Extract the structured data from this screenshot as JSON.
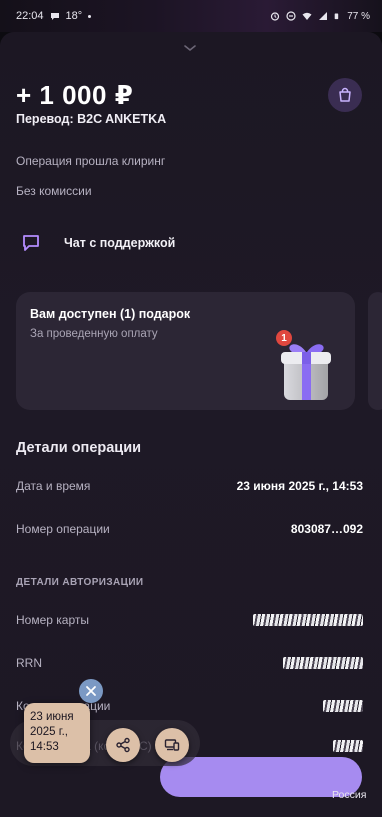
{
  "statusbar": {
    "time": "22:04",
    "temp": "18°",
    "battery": "77 %"
  },
  "header": {
    "amount": "+ 1 000 ₽",
    "subtitle": "Перевод: B2C ANKETKA",
    "bag_icon": "shopping-bag-icon"
  },
  "info": {
    "line1": "Операция прошла клиринг",
    "line2": "Без комиссии"
  },
  "chat": {
    "label": "Чат с поддержкой",
    "icon": "chat-bubble-icon"
  },
  "gift": {
    "title": "Вам доступен (1) подарок",
    "subtitle": "За проведенную оплату",
    "badge": "1"
  },
  "details": {
    "title": "Детали операции",
    "rows": [
      {
        "key": "Дата и время",
        "value": "23 июня 2025 г., 14:53"
      },
      {
        "key": "Номер операции",
        "value": "803087…092"
      }
    ],
    "auth_title": "ДЕТАЛИ АВТОРИЗАЦИИ",
    "auth_rows": [
      {
        "key": "Номер карты"
      },
      {
        "key": "RRN"
      },
      {
        "key": "Код авторизации"
      },
      {
        "key": "Код магазина (код MCC)"
      }
    ],
    "bottom_value": "Россия"
  },
  "floating": {
    "bubble_text": "23 июня 2025 г., 14:53"
  },
  "colors": {
    "accent": "#a68bf0",
    "chat_icon": "#b48cff",
    "gift_ribbon": "#8a6cf2",
    "badge": "#e0473f"
  }
}
